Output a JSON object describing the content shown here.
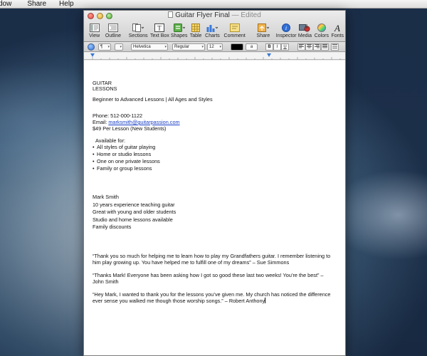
{
  "menubar": {
    "items": [
      "dow",
      "Share",
      "Help"
    ]
  },
  "window": {
    "title": "Guitar Flyer Final",
    "title_status": "— Edited"
  },
  "toolbar": {
    "items": [
      {
        "label": "View",
        "icon": "view-icon"
      },
      {
        "label": "Outline",
        "icon": "outline-icon"
      },
      {
        "label": "Sections",
        "icon": "sections-icon"
      },
      {
        "label": "Text Box",
        "icon": "text-box-icon"
      },
      {
        "label": "Shapes",
        "icon": "shapes-icon"
      },
      {
        "label": "Table",
        "icon": "table-icon"
      },
      {
        "label": "Charts",
        "icon": "charts-icon"
      },
      {
        "label": "Comment",
        "icon": "comment-icon"
      },
      {
        "label": "Share",
        "icon": "share-icon"
      },
      {
        "label": "Inspector",
        "icon": "inspector-icon"
      },
      {
        "label": "Media",
        "icon": "media-icon"
      },
      {
        "label": "Colors",
        "icon": "colors-icon"
      },
      {
        "label": "Fonts",
        "icon": "fonts-icon"
      }
    ]
  },
  "formatbar": {
    "style_value": "¶",
    "font_value": "Helvetica",
    "typeface_value": "Regular",
    "size_value": "12",
    "text_color": "#000000",
    "highlight_value": "a",
    "bold": "B",
    "italic": "I",
    "underline": "U"
  },
  "document": {
    "heading_line1": "GUITAR",
    "heading_line2": "LESSONS",
    "tagline": "Beginner to Advanced Lessons | All Ages and Styles",
    "phone": "Phone: 512-000-1122",
    "email_label": "Email: ",
    "email_link": "marksmith@guitarpassion.com",
    "price": "$49 Per Lesson (New Students)",
    "available_heading": "Available for:",
    "available_items": [
      "All styles of guitar playing",
      "Home or studio lessons",
      "One on one private lessons",
      "Family or group lessons"
    ],
    "bio": [
      "Mark Smith",
      "10 years experience teaching guitar",
      "Great with young and older students",
      "Studio and home lessons available",
      "Family discounts"
    ],
    "testimonials": [
      "“Thank you so much for helping me to learn how to play my Grandfathers guitar. I remember listening to him play growing up. You have helped me to fulfill one of my dreams” – Sue Simmons",
      "“Thanks Mark! Everyone has been asking how I got so good these last two weeks! You’re the best” – John Smith",
      "“Hey Mark, I wanted to thank you for the lessons you’ve given me. My church has noticed the difference ever sense you walked me though those worship songs.” – Robert Anthony"
    ]
  },
  "colors": {
    "link": "#1a3fc6",
    "page": "#ffffff"
  }
}
